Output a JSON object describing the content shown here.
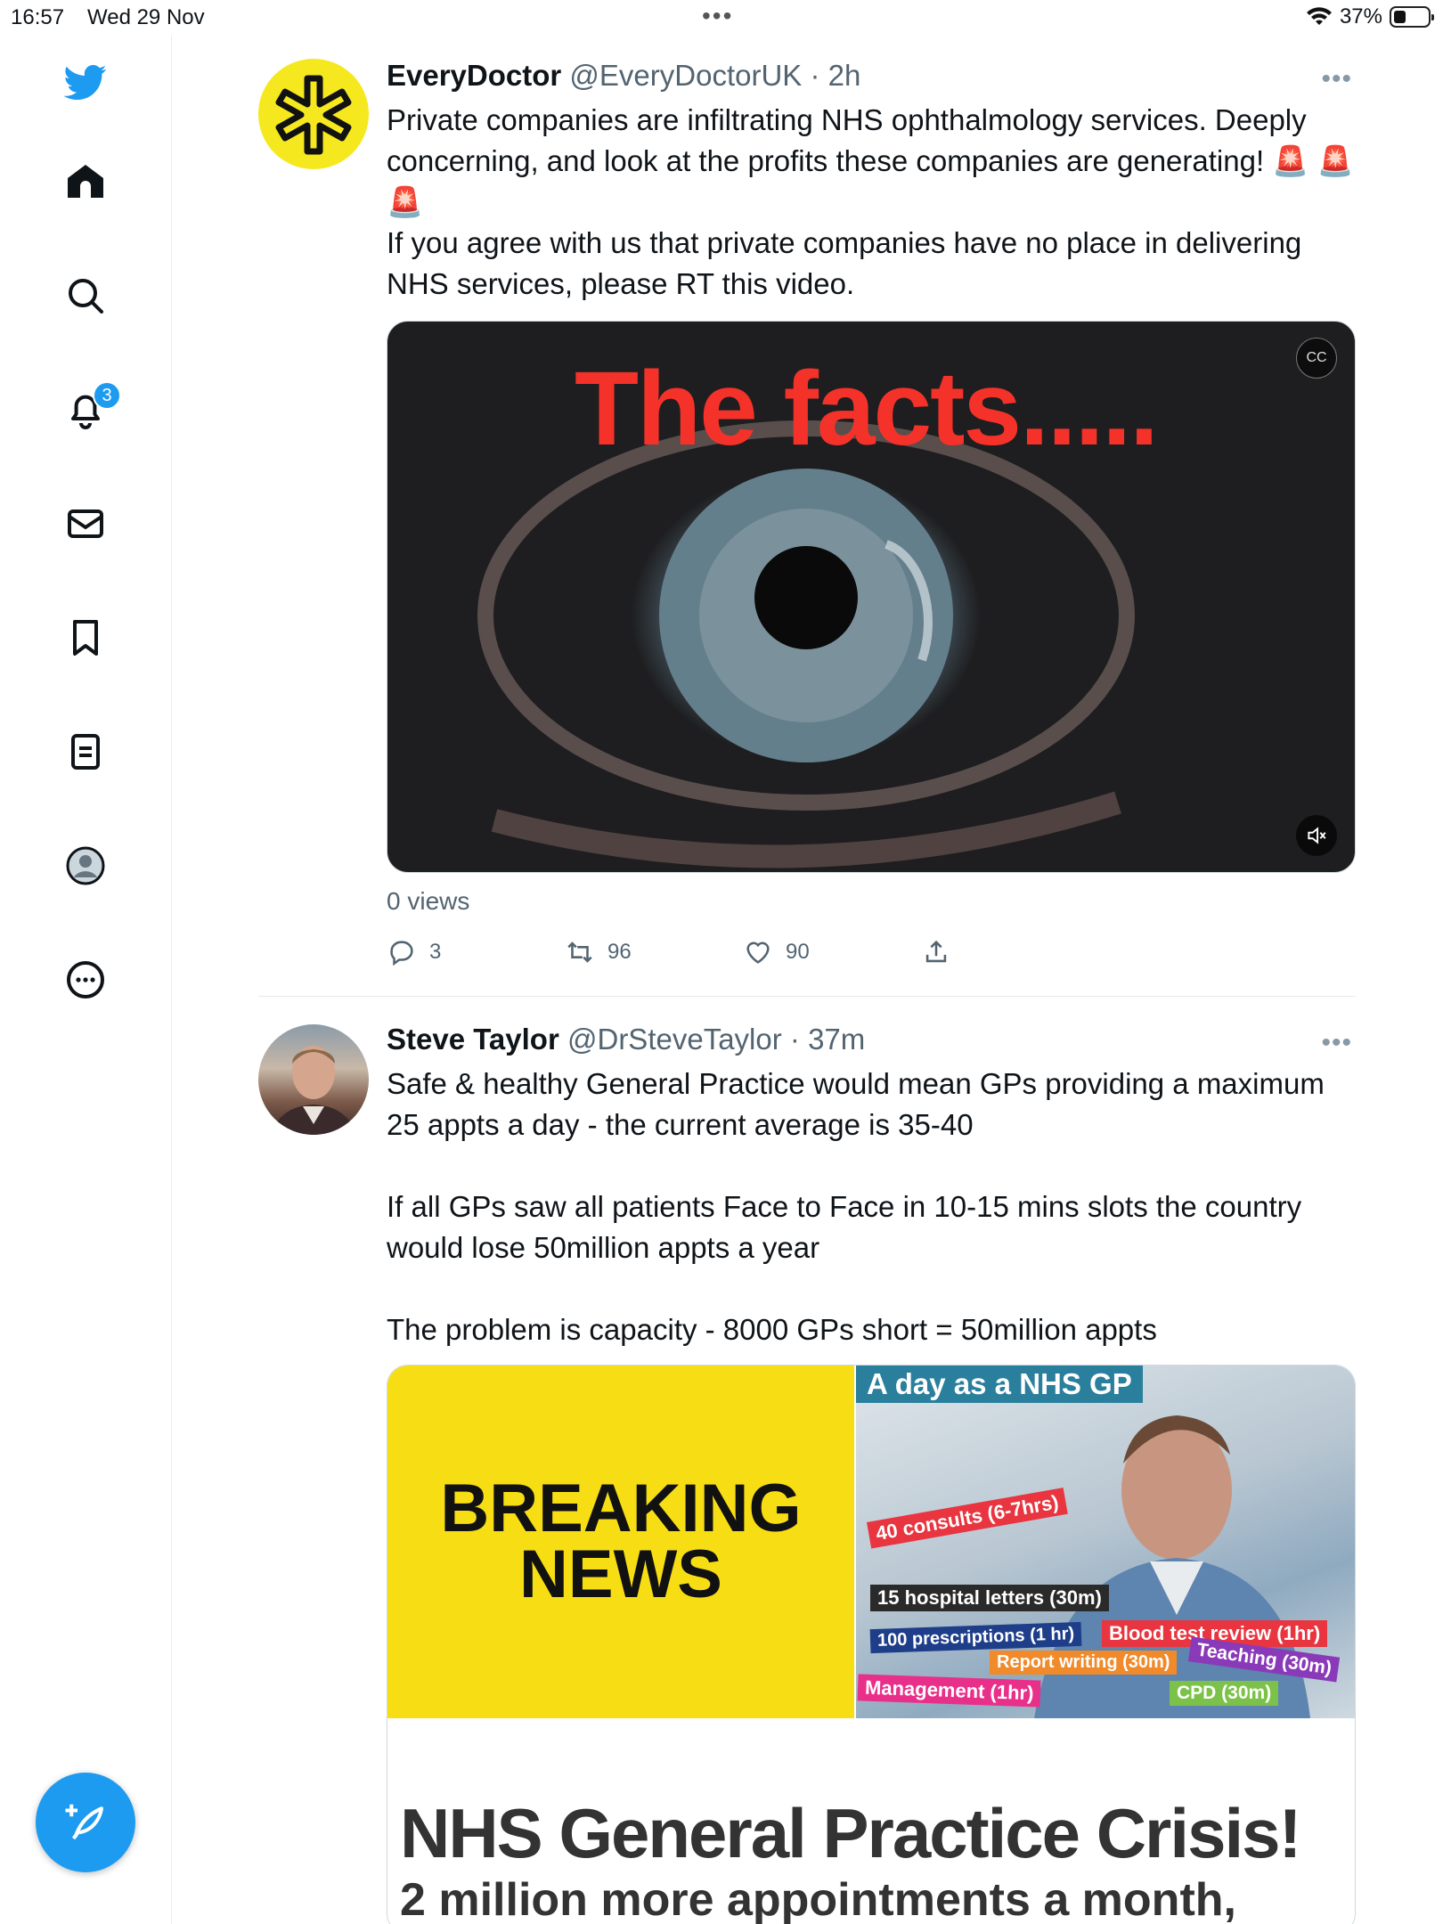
{
  "status": {
    "time": "16:57",
    "date": "Wed 29 Nov",
    "battery": "37%",
    "battery_level": 0.37
  },
  "sidebar": {
    "items": [
      "twitter-logo",
      "home",
      "explore",
      "notifications",
      "messages",
      "bookmarks",
      "lists",
      "profile",
      "more"
    ],
    "notifications_badge": "3",
    "colors": {
      "accent": "#1d9bf0"
    }
  },
  "tweets": [
    {
      "name": "EveryDoctor",
      "handle": "@EveryDoctorUK",
      "sep": "·",
      "ago": "2h",
      "lines": [
        "Private companies are infiltrating NHS ophthalmology services. Deeply concerning, and look at the profits these companies are generating! 🚨 🚨 🚨",
        "If you agree with us that private companies have no place in delivering NHS services, please RT this video."
      ],
      "video_overlay": "The facts.....",
      "views": "0 views",
      "replies": "3",
      "retweets": "96",
      "likes": "90"
    },
    {
      "name": "Steve Taylor",
      "handle": "@DrSteveTaylor",
      "sep": "·",
      "ago": "37m",
      "lines": [
        "Safe & healthy General Practice would mean GPs providing a maximum 25 appts a day - the current average is 35-40",
        "",
        "If all GPs saw all patients Face to Face in 10-15 mins slots the country would lose 50million appts a year",
        "",
        "The problem is capacity - 8000 GPs short = 50million appts"
      ],
      "image": {
        "breaking_line1": "BREAKING",
        "breaking_line2": "NEWS",
        "gp_title": "A day as a NHS GP",
        "tags": [
          "40 consults (6-7hrs)",
          "15 hospital letters (30m)",
          "100 prescriptions (1 hr)",
          "Blood test review (1hr)",
          "Report writing (30m)",
          "Teaching (30m)",
          "Management (1hr)",
          "CPD (30m)"
        ],
        "headline": "NHS General Practice Crisis!",
        "subheadline": "2 million more appointments a month,"
      }
    }
  ]
}
